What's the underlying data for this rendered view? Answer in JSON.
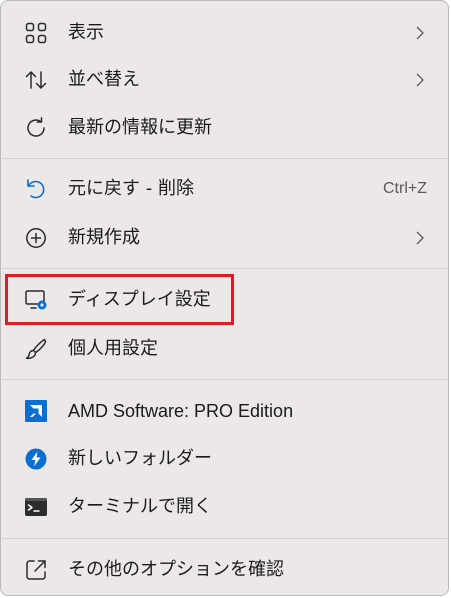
{
  "menu": {
    "items": [
      {
        "label": "表示",
        "icon": "grid-view-icon",
        "has_submenu": true
      },
      {
        "label": "並べ替え",
        "icon": "sort-arrows-icon",
        "has_submenu": true
      },
      {
        "label": "最新の情報に更新",
        "icon": "refresh-icon",
        "has_submenu": false
      },
      {
        "label": "元に戻す - 削除",
        "icon": "undo-icon",
        "shortcut": "Ctrl+Z",
        "has_submenu": false
      },
      {
        "label": "新規作成",
        "icon": "add-circle-icon",
        "has_submenu": true
      },
      {
        "label": "ディスプレイ設定",
        "icon": "display-settings-icon",
        "has_submenu": false,
        "highlighted": true
      },
      {
        "label": "個人用設定",
        "icon": "brush-icon",
        "has_submenu": false
      },
      {
        "label": "AMD Software: PRO Edition",
        "icon": "amd-logo-icon",
        "has_submenu": false
      },
      {
        "label": "新しいフォルダー",
        "icon": "bolt-circle-icon",
        "has_submenu": false
      },
      {
        "label": "ターミナルで開く",
        "icon": "terminal-icon",
        "has_submenu": false
      },
      {
        "label": "その他のオプションを確認",
        "icon": "share-external-icon",
        "has_submenu": false
      }
    ]
  },
  "colors": {
    "menu_background": "#ece8e8",
    "text": "#1b1b1b",
    "highlight_border": "#e01b24",
    "accent_blue": "#0b6fd1"
  }
}
